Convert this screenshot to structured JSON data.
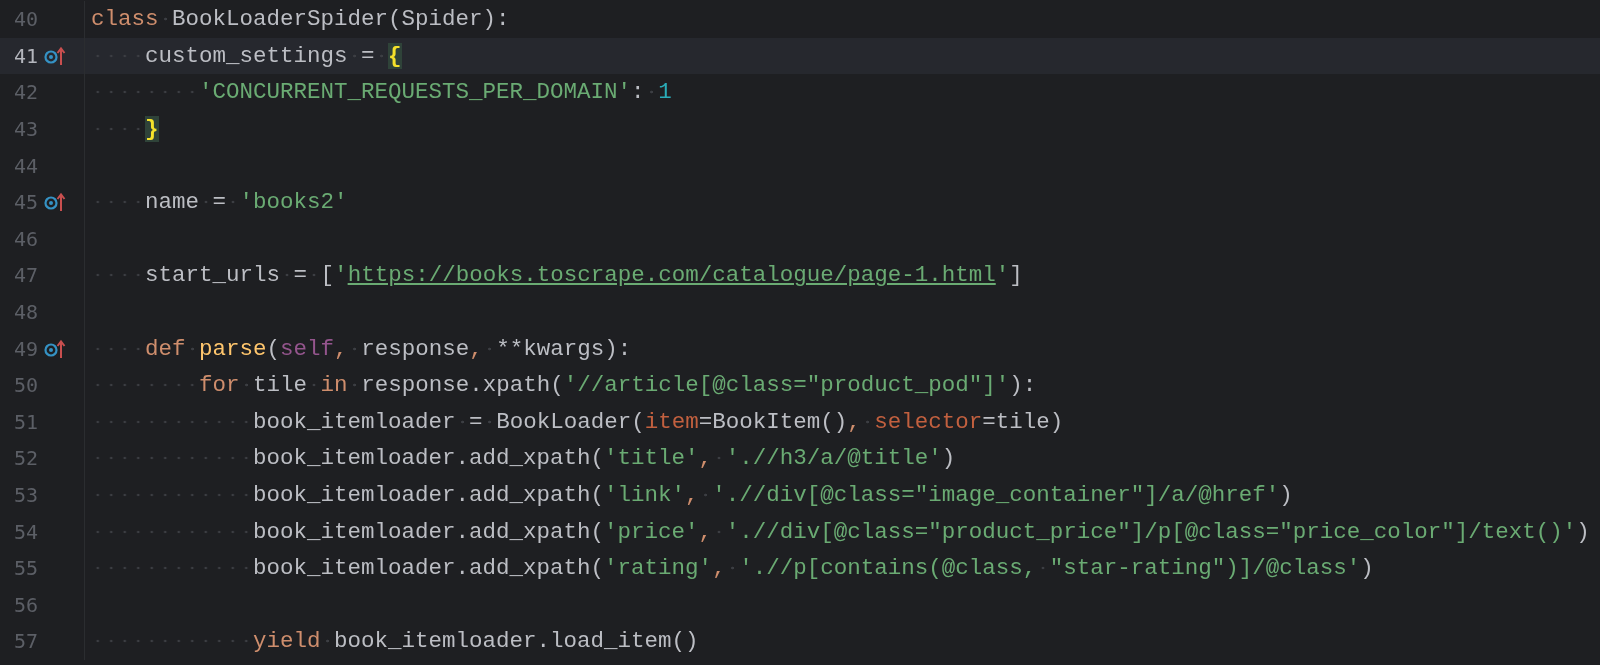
{
  "editor": {
    "lines": [
      {
        "number": "40",
        "current": false,
        "override_mark": false,
        "tokens": [
          {
            "kind": "kw",
            "text": "class "
          },
          {
            "kind": "id",
            "text": "BookLoaderSpider(Spider):"
          }
        ]
      },
      {
        "number": "41",
        "current": true,
        "override_mark": true,
        "tokens": [
          {
            "kind": "id",
            "text": "    custom_settings = "
          },
          {
            "kind": "brace",
            "text": "{"
          }
        ]
      },
      {
        "number": "42",
        "current": false,
        "override_mark": false,
        "tokens": [
          {
            "kind": "str",
            "text": "        'CONCURRENT_REQUESTS_PER_DOMAIN'"
          },
          {
            "kind": "id",
            "text": ": "
          },
          {
            "kind": "num",
            "text": "1"
          }
        ]
      },
      {
        "number": "43",
        "current": false,
        "override_mark": false,
        "tokens": [
          {
            "kind": "brace",
            "text": "    }"
          }
        ]
      },
      {
        "number": "44",
        "current": false,
        "override_mark": false
      },
      {
        "number": "45",
        "current": false,
        "override_mark": true,
        "tokens": [
          {
            "kind": "id",
            "text": "    name = "
          },
          {
            "kind": "str",
            "text": "'books2'"
          }
        ]
      },
      {
        "number": "46",
        "current": false,
        "override_mark": false
      },
      {
        "number": "47",
        "current": false,
        "override_mark": false,
        "tokens": [
          {
            "kind": "id",
            "text": "    start_urls = ["
          },
          {
            "kind": "str",
            "text": "'"
          },
          {
            "kind": "url",
            "text": "https://books.toscrape.com/catalogue/page-1.html"
          },
          {
            "kind": "str",
            "text": "'"
          },
          {
            "kind": "id",
            "text": "]"
          }
        ]
      },
      {
        "number": "48",
        "current": false,
        "override_mark": false
      },
      {
        "number": "49",
        "current": false,
        "override_mark": true,
        "tokens": [
          {
            "kind": "kw",
            "text": "    def "
          },
          {
            "kind": "fn",
            "text": "parse"
          },
          {
            "kind": "id",
            "text": "("
          },
          {
            "kind": "self",
            "text": "self"
          },
          {
            "kind": "kw",
            "text": ", "
          },
          {
            "kind": "id",
            "text": "response"
          },
          {
            "kind": "kw",
            "text": ", "
          },
          {
            "kind": "id",
            "text": "**kwargs):"
          }
        ]
      },
      {
        "number": "50",
        "current": false,
        "override_mark": false,
        "tokens": [
          {
            "kind": "kw",
            "text": "        for "
          },
          {
            "kind": "id",
            "text": "tile "
          },
          {
            "kind": "kw",
            "text": "in "
          },
          {
            "kind": "id",
            "text": "response.xpath("
          },
          {
            "kind": "str",
            "text": "'//article[@class=\"product_pod\"]'"
          },
          {
            "kind": "id",
            "text": "):"
          }
        ]
      },
      {
        "number": "51",
        "current": false,
        "override_mark": false,
        "tokens": [
          {
            "kind": "id",
            "text": "            book_itemloader = BookLoader("
          },
          {
            "kind": "kwarg",
            "text": "item"
          },
          {
            "kind": "id",
            "text": "=BookItem()"
          },
          {
            "kind": "kw",
            "text": ", "
          },
          {
            "kind": "kwarg",
            "text": "selector"
          },
          {
            "kind": "id",
            "text": "=tile)"
          }
        ]
      },
      {
        "number": "52",
        "current": false,
        "override_mark": false,
        "tokens": [
          {
            "kind": "id",
            "text": "            book_itemloader.add_xpath("
          },
          {
            "kind": "str",
            "text": "'title'"
          },
          {
            "kind": "kw",
            "text": ", "
          },
          {
            "kind": "str",
            "text": "'.//h3/a/@title'"
          },
          {
            "kind": "id",
            "text": ")"
          }
        ]
      },
      {
        "number": "53",
        "current": false,
        "override_mark": false,
        "tokens": [
          {
            "kind": "id",
            "text": "            book_itemloader.add_xpath("
          },
          {
            "kind": "str",
            "text": "'link'"
          },
          {
            "kind": "kw",
            "text": ", "
          },
          {
            "kind": "str",
            "text": "'.//div[@class=\"image_container\"]/a/@href'"
          },
          {
            "kind": "id",
            "text": ")"
          }
        ]
      },
      {
        "number": "54",
        "current": false,
        "override_mark": false,
        "tokens": [
          {
            "kind": "id",
            "text": "            book_itemloader.add_xpath("
          },
          {
            "kind": "str",
            "text": "'price'"
          },
          {
            "kind": "kw",
            "text": ", "
          },
          {
            "kind": "str",
            "text": "'.//div[@class=\"product_price\"]/p[@class=\"price_color\"]/text()'"
          },
          {
            "kind": "id",
            "text": ")"
          }
        ]
      },
      {
        "number": "55",
        "current": false,
        "override_mark": false,
        "tokens": [
          {
            "kind": "id",
            "text": "            book_itemloader.add_xpath("
          },
          {
            "kind": "str",
            "text": "'rating'"
          },
          {
            "kind": "kw",
            "text": ", "
          },
          {
            "kind": "str",
            "text": "'.//p[contains(@class, \"star-rating\")]/@class'"
          },
          {
            "kind": "id",
            "text": ")"
          }
        ]
      },
      {
        "number": "56",
        "current": false,
        "override_mark": false
      },
      {
        "number": "57",
        "current": false,
        "override_mark": false,
        "tokens": [
          {
            "kind": "kw",
            "text": "            yield "
          },
          {
            "kind": "id",
            "text": "book_itemloader.load_item()"
          }
        ]
      }
    ]
  }
}
